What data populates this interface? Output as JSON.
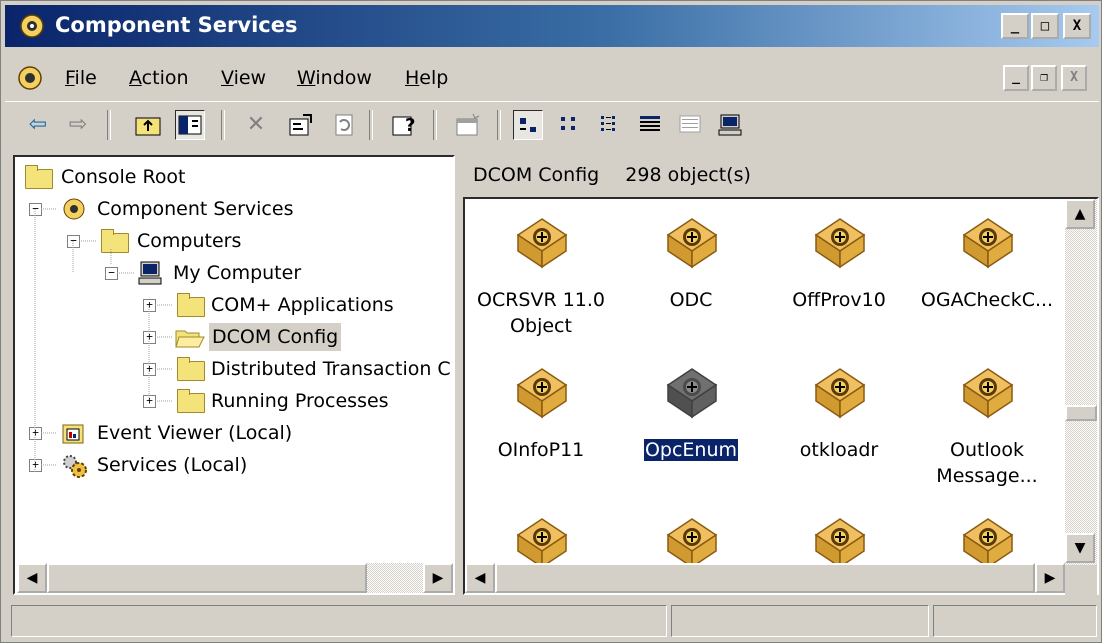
{
  "window": {
    "title": "Component Services",
    "controls": {
      "minimize": "_",
      "maximize": "□",
      "close": "X"
    }
  },
  "menu": {
    "items": [
      {
        "label": "File",
        "accel": "F"
      },
      {
        "label": "Action",
        "accel": "A"
      },
      {
        "label": "View",
        "accel": "V"
      },
      {
        "label": "Window",
        "accel": "W"
      },
      {
        "label": "Help",
        "accel": "H"
      }
    ],
    "mdi_controls": {
      "minimize": "_",
      "restore": "❐",
      "close": "X"
    }
  },
  "toolbar": {
    "icons": [
      "back-icon",
      "forward-icon",
      "up-folder-icon",
      "show-hide-tree-icon",
      "delete-icon",
      "properties-icon",
      "refresh-icon",
      "help-icon",
      "new-window-icon",
      "large-icons-view-icon",
      "small-icons-view-icon",
      "list-view-icon",
      "detail-view-icon",
      "status-view-icon",
      "computer-icon"
    ],
    "glyphs": {
      "back": "⇦",
      "forward": "⇨",
      "delete": "✕",
      "help": "?"
    }
  },
  "tree": {
    "items": [
      {
        "label": "Console Root",
        "level": 0,
        "expander": "",
        "icon": "folder-icon"
      },
      {
        "label": "Component Services",
        "level": 1,
        "expander": "−",
        "icon": "component-services-icon"
      },
      {
        "label": "Computers",
        "level": 2,
        "expander": "−",
        "icon": "folder-icon"
      },
      {
        "label": "My Computer",
        "level": 3,
        "expander": "−",
        "icon": "computer-icon"
      },
      {
        "label": "COM+ Applications",
        "level": 4,
        "expander": "+",
        "icon": "folder-icon"
      },
      {
        "label": "DCOM Config",
        "level": 4,
        "expander": "+",
        "icon": "open-folder-icon",
        "selected": true
      },
      {
        "label": "Distributed Transaction C",
        "level": 4,
        "expander": "+",
        "icon": "folder-icon"
      },
      {
        "label": "Running Processes",
        "level": 4,
        "expander": "+",
        "icon": "folder-icon"
      },
      {
        "label": "Event Viewer (Local)",
        "level": 1,
        "expander": "+",
        "icon": "event-viewer-icon"
      },
      {
        "label": "Services (Local)",
        "level": 1,
        "expander": "+",
        "icon": "services-icon"
      }
    ]
  },
  "content": {
    "header_title": "DCOM Config",
    "header_count": "298 object(s)",
    "items": [
      {
        "label": "OCRSVR 11.0 Object",
        "selected": false,
        "disabled": false
      },
      {
        "label": "ODC",
        "selected": false,
        "disabled": false
      },
      {
        "label": "OffProv10",
        "selected": false,
        "disabled": false
      },
      {
        "label": "OGACheckC...",
        "selected": false,
        "disabled": false
      },
      {
        "label": "OInfoP11",
        "selected": false,
        "disabled": false
      },
      {
        "label": "OpcEnum",
        "selected": true,
        "disabled": true
      },
      {
        "label": "otkloadr",
        "selected": false,
        "disabled": false
      },
      {
        "label": "Outlook Message...",
        "selected": false,
        "disabled": false
      },
      {
        "label": "",
        "selected": false,
        "disabled": false
      },
      {
        "label": "",
        "selected": false,
        "disabled": false
      },
      {
        "label": "",
        "selected": false,
        "disabled": false
      },
      {
        "label": "",
        "selected": false,
        "disabled": false
      }
    ]
  },
  "scroll": {
    "up": "▲",
    "down": "▼",
    "left": "◀",
    "right": "▶"
  },
  "colors": {
    "titlebar_start": "#0a246a",
    "titlebar_end": "#a6caf0",
    "face": "#d4d0c8",
    "selection": "#0a246a",
    "package": "#f0c060"
  }
}
